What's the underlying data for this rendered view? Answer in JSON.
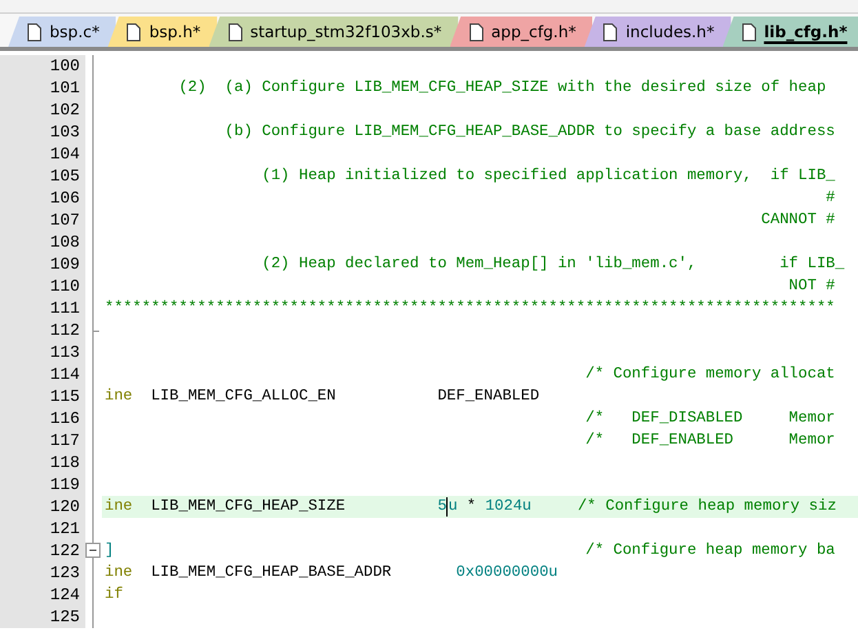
{
  "tabs": [
    {
      "label": "bsp.c*",
      "color": "#c9d7f0",
      "selected": false
    },
    {
      "label": "bsp.h*",
      "color": "#fbe08a",
      "selected": false
    },
    {
      "label": "startup_stm32f103xb.s*",
      "color": "#c6d6a6",
      "selected": false
    },
    {
      "label": "app_cfg.h*",
      "color": "#efa4a4",
      "selected": false
    },
    {
      "label": "includes.h*",
      "color": "#c6b4e6",
      "selected": false
    },
    {
      "label": "lib_cfg.h*",
      "color": "#a6cfbf",
      "selected": true
    }
  ],
  "lines": [
    {
      "number": "100",
      "current": false
    },
    {
      "number": "101",
      "current": false,
      "segments": [
        {
          "kind": "comment",
          "text": "        (2)  (a) Configure LIB_MEM_CFG_HEAP_SIZE with the desired size of heap"
        }
      ]
    },
    {
      "number": "102",
      "current": false
    },
    {
      "number": "103",
      "current": false,
      "segments": [
        {
          "kind": "comment",
          "text": "             (b) Configure LIB_MEM_CFG_HEAP_BASE_ADDR to specify a base address"
        }
      ]
    },
    {
      "number": "104",
      "current": false
    },
    {
      "number": "105",
      "current": false,
      "segments": [
        {
          "kind": "comment",
          "text": "                 (1) Heap initialized to specified application memory,  if LIB_"
        }
      ]
    },
    {
      "number": "106",
      "current": false,
      "segments": [
        {
          "kind": "comment",
          "text": "                                                                              #"
        }
      ]
    },
    {
      "number": "107",
      "current": false,
      "segments": [
        {
          "kind": "comment",
          "text": "                                                                       CANNOT #"
        }
      ]
    },
    {
      "number": "108",
      "current": false
    },
    {
      "number": "109",
      "current": false,
      "segments": [
        {
          "kind": "comment",
          "text": "                 (2) Heap declared to Mem_Heap[] in 'lib_mem.c',         if LIB_"
        }
      ]
    },
    {
      "number": "110",
      "current": false,
      "segments": [
        {
          "kind": "comment",
          "text": "                                                                          NOT #"
        }
      ]
    },
    {
      "number": "111",
      "current": false,
      "segments": [
        {
          "kind": "comment",
          "text": "*******************************************************************************"
        }
      ]
    },
    {
      "number": "112",
      "current": false,
      "fold_end": true
    },
    {
      "number": "113",
      "current": false
    },
    {
      "number": "114",
      "current": false,
      "segments": [
        {
          "kind": "comment",
          "text": "                                                    /* Configure memory allocat"
        }
      ]
    },
    {
      "number": "115",
      "current": false,
      "segments": [
        {
          "kind": "keyword",
          "text": "ine"
        },
        {
          "kind": "plain",
          "text": "  LIB_MEM_CFG_ALLOC_EN           DEF_ENABLED"
        }
      ]
    },
    {
      "number": "116",
      "current": false,
      "segments": [
        {
          "kind": "comment",
          "text": "                                                    /*   DEF_DISABLED     Memor"
        }
      ]
    },
    {
      "number": "117",
      "current": false,
      "segments": [
        {
          "kind": "comment",
          "text": "                                                    /*   DEF_ENABLED      Memor"
        }
      ]
    },
    {
      "number": "118",
      "current": false
    },
    {
      "number": "119",
      "current": false
    },
    {
      "number": "120",
      "current": true,
      "segments": [
        {
          "kind": "keyword",
          "text": "ine"
        },
        {
          "kind": "plain",
          "text": "  LIB_MEM_CFG_HEAP_SIZE          "
        },
        {
          "kind": "number",
          "text": "5"
        },
        {
          "kind": "cursor"
        },
        {
          "kind": "number",
          "text": "u"
        },
        {
          "kind": "plain",
          "text": " * "
        },
        {
          "kind": "number",
          "text": "1024u"
        },
        {
          "kind": "comment",
          "text": "     /* Configure heap memory siz"
        }
      ]
    },
    {
      "number": "121",
      "current": false
    },
    {
      "number": "122",
      "current": false,
      "collapsible": true,
      "segments": [
        {
          "kind": "number",
          "text": "]"
        },
        {
          "kind": "comment",
          "text": "                                                   /* Configure heap memory ba"
        }
      ]
    },
    {
      "number": "123",
      "current": false,
      "segments": [
        {
          "kind": "keyword",
          "text": "ine"
        },
        {
          "kind": "plain",
          "text": "  LIB_MEM_CFG_HEAP_BASE_ADDR       "
        },
        {
          "kind": "number",
          "text": "0x00000000u"
        }
      ]
    },
    {
      "number": "124",
      "current": false,
      "segments": [
        {
          "kind": "keyword",
          "text": "if"
        }
      ]
    },
    {
      "number": "125",
      "current": false
    }
  ]
}
